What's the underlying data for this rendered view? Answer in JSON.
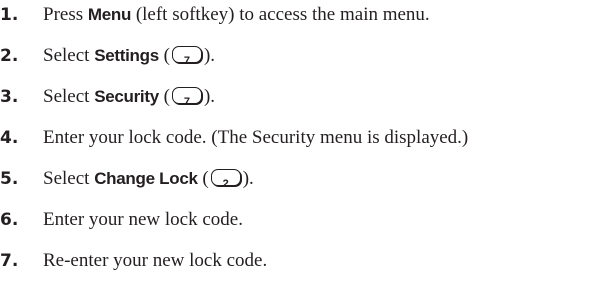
{
  "steps": [
    {
      "number": "1.",
      "before": "Press ",
      "term": "Menu",
      "after": " (left softkey) to access the main menu."
    },
    {
      "number": "2.",
      "before": "Select ",
      "term": "Settings",
      "paren_open": " (",
      "key": "7",
      "paren_close": ")."
    },
    {
      "number": "3.",
      "before": "Select ",
      "term": "Security",
      "paren_open": " (",
      "key": "7",
      "paren_close": ")."
    },
    {
      "number": "4.",
      "text": "Enter your lock code. (The Security menu is displayed.)"
    },
    {
      "number": "5.",
      "before": "Select ",
      "term": "Change Lock",
      "paren_open": " (",
      "key": "2",
      "paren_close": ")."
    },
    {
      "number": "6.",
      "text": "Enter your new lock code."
    },
    {
      "number": "7.",
      "text": "Re-enter your new lock code."
    }
  ]
}
